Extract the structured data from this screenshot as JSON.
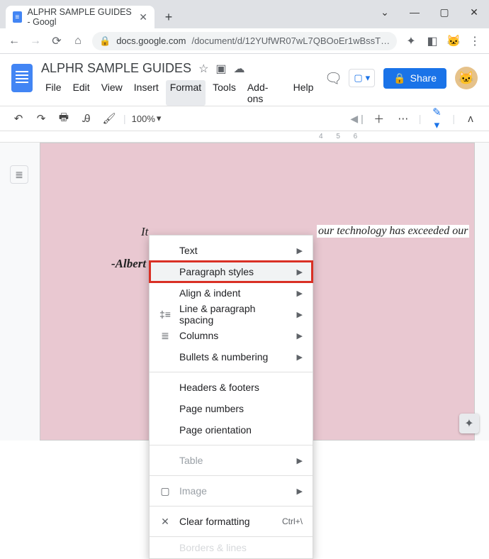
{
  "browser": {
    "tab_title": "ALPHR SAMPLE GUIDES - Googl",
    "url_host": "docs.google.com",
    "url_path": "/document/d/12YUfWR07wL7QBOoEr1wBssT…"
  },
  "header": {
    "doc_title": "ALPHR SAMPLE GUIDES",
    "menus": [
      "File",
      "Edit",
      "View",
      "Insert",
      "Format",
      "Tools",
      "Add-ons",
      "Help"
    ],
    "active_menu_index": 4,
    "share_label": "Share"
  },
  "toolbar": {
    "zoom": "100%"
  },
  "ruler": {
    "right": "4       5       6"
  },
  "document": {
    "fragment_left": "It",
    "fragment_right": "our technology has exceeded our",
    "attribution": "-Albert"
  },
  "format_menu": {
    "items": [
      {
        "label": "Text",
        "icon": "",
        "arrow": true
      },
      {
        "label": "Paragraph styles",
        "icon": "",
        "arrow": true,
        "highlight": true
      },
      {
        "label": "Align & indent",
        "icon": "",
        "arrow": true
      },
      {
        "label": "Line & paragraph spacing",
        "icon": "‡≡",
        "arrow": true
      },
      {
        "label": "Columns",
        "icon": "≣",
        "arrow": true
      },
      {
        "label": "Bullets & numbering",
        "icon": "",
        "arrow": true
      },
      {
        "sep": true
      },
      {
        "label": "Headers & footers",
        "icon": ""
      },
      {
        "label": "Page numbers",
        "icon": ""
      },
      {
        "label": "Page orientation",
        "icon": ""
      },
      {
        "sep": true
      },
      {
        "label": "Table",
        "icon": "",
        "arrow": true,
        "disabled": true
      },
      {
        "sep": true
      },
      {
        "label": "Image",
        "icon": "▢",
        "arrow": true,
        "disabled": true
      },
      {
        "sep": true
      },
      {
        "label": "Clear formatting",
        "icon": "✕",
        "shortcut": "Ctrl+\\"
      },
      {
        "sep": true
      },
      {
        "label": "Borders & lines",
        "icon": "",
        "disabled": true,
        "dim": true
      }
    ]
  }
}
